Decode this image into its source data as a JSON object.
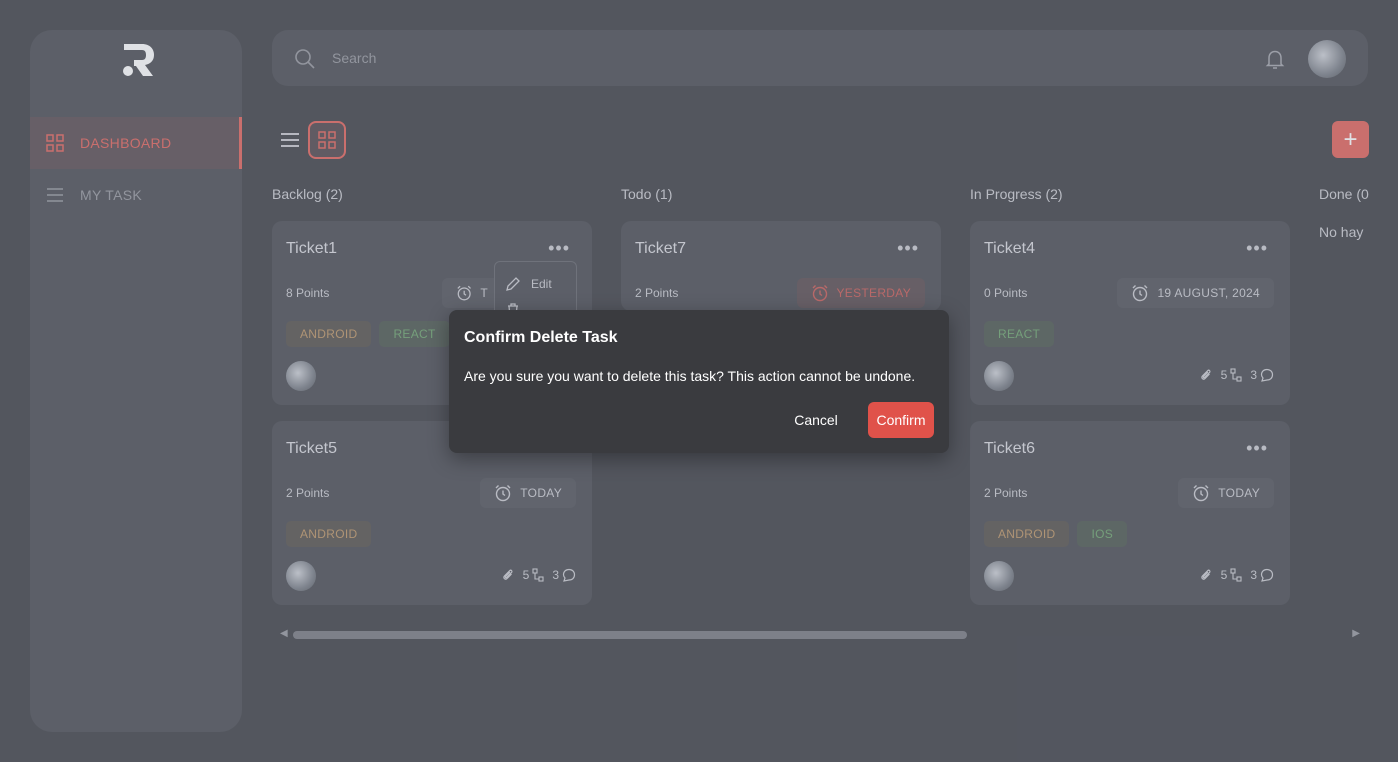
{
  "sidebar": {
    "items": [
      {
        "label": "DASHBOARD",
        "icon": "grid-icon",
        "active": true
      },
      {
        "label": "MY TASK",
        "icon": "list-icon",
        "active": false
      }
    ]
  },
  "header": {
    "search_placeholder": "Search"
  },
  "columns": [
    {
      "title": "Backlog (2)"
    },
    {
      "title": "Todo (1)"
    },
    {
      "title": "In Progress (2)"
    },
    {
      "title": "Done (0",
      "empty_text": "No hay"
    }
  ],
  "cards": [
    {
      "title": "Ticket1",
      "points": "8 Points",
      "date": "T",
      "tags": [
        "ANDROID",
        "REACT"
      ]
    },
    {
      "title": "Ticket5",
      "points": "2 Points",
      "date": "TODAY",
      "tags": [
        "ANDROID"
      ],
      "attachments": "5",
      "comments": "3"
    },
    {
      "title": "Ticket7",
      "points": "2 Points",
      "date": "YESTERDAY"
    },
    {
      "title": "Ticket4",
      "points": "0 Points",
      "date": "19 AUGUST, 2024",
      "tags": [
        "REACT"
      ],
      "attachments": "5",
      "comments": "3"
    },
    {
      "title": "Ticket6",
      "points": "2 Points",
      "date": "TODAY",
      "tags": [
        "ANDROID",
        "IOS"
      ],
      "attachments": "5",
      "comments": "3"
    }
  ],
  "context_menu": {
    "edit": "Edit"
  },
  "modal": {
    "title": "Confirm Delete Task",
    "body": "Are you sure you want to delete this task? This action cannot be undone.",
    "cancel": "Cancel",
    "confirm": "Confirm"
  },
  "colors": {
    "accent": "#e0524a",
    "background": "#2b2d33",
    "surface": "#393b42"
  }
}
